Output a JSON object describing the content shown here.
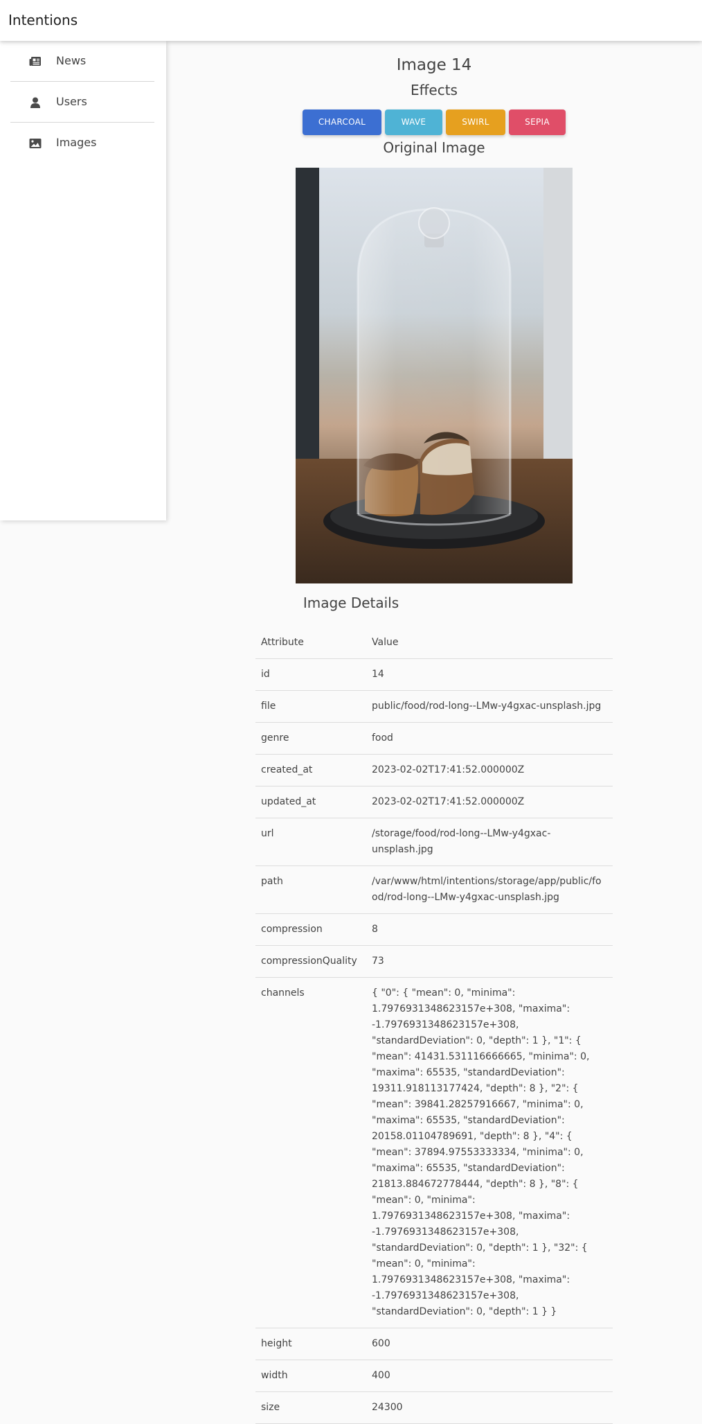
{
  "app": {
    "title": "Intentions"
  },
  "sidebar": {
    "items": [
      {
        "label": "News",
        "icon": "newspaper-icon"
      },
      {
        "label": "Users",
        "icon": "user-icon"
      },
      {
        "label": "Images",
        "icon": "image-icon"
      }
    ]
  },
  "main": {
    "title": "Image 14",
    "effects_title": "Effects",
    "effects": [
      {
        "label": "CHARCOAL",
        "color": "#3c6fd2"
      },
      {
        "label": "WAVE",
        "color": "#4fb3d5"
      },
      {
        "label": "SWIRL",
        "color": "#e6a01f"
      },
      {
        "label": "SEPIA",
        "color": "#e04e68"
      }
    ],
    "original_title": "Original Image",
    "image_alt": "Pastries under a glass cloche on a wooden table"
  },
  "details": {
    "title": "Image Details",
    "header": {
      "attribute": "Attribute",
      "value": "Value"
    },
    "rows": [
      {
        "attribute": "id",
        "value": "14"
      },
      {
        "attribute": "file",
        "value": "public/food/rod-long--LMw-y4gxac-unsplash.jpg"
      },
      {
        "attribute": "genre",
        "value": "food"
      },
      {
        "attribute": "created_at",
        "value": "2023-02-02T17:41:52.000000Z"
      },
      {
        "attribute": "updated_at",
        "value": "2023-02-02T17:41:52.000000Z"
      },
      {
        "attribute": "url",
        "value": "/storage/food/rod-long--LMw-y4gxac-unsplash.jpg"
      },
      {
        "attribute": "path",
        "value": "/var/www/html/intentions/storage/app/public/food/rod-long--LMw-y4gxac-unsplash.jpg"
      },
      {
        "attribute": "compression",
        "value": "8"
      },
      {
        "attribute": "compressionQuality",
        "value": "73"
      },
      {
        "attribute": "channels",
        "value": "{ \"0\": { \"mean\": 0, \"minima\": 1.7976931348623157e+308, \"maxima\": -1.7976931348623157e+308, \"standardDeviation\": 0, \"depth\": 1 }, \"1\": { \"mean\": 41431.531116666665, \"minima\": 0, \"maxima\": 65535, \"standardDeviation\": 19311.918113177424, \"depth\": 8 }, \"2\": { \"mean\": 39841.28257916667, \"minima\": 0, \"maxima\": 65535, \"standardDeviation\": 20158.01104789691, \"depth\": 8 }, \"4\": { \"mean\": 37894.97553333334, \"minima\": 0, \"maxima\": 65535, \"standardDeviation\": 21813.884672778444, \"depth\": 8 }, \"8\": { \"mean\": 0, \"minima\": 1.7976931348623157e+308, \"maxima\": -1.7976931348623157e+308, \"standardDeviation\": 0, \"depth\": 1 }, \"32\": { \"mean\": 0, \"minima\": 1.7976931348623157e+308, \"maxima\": -1.7976931348623157e+308, \"standardDeviation\": 0, \"depth\": 1 } }"
      },
      {
        "attribute": "height",
        "value": "600"
      },
      {
        "attribute": "width",
        "value": "400"
      },
      {
        "attribute": "size",
        "value": "24300"
      }
    ]
  }
}
